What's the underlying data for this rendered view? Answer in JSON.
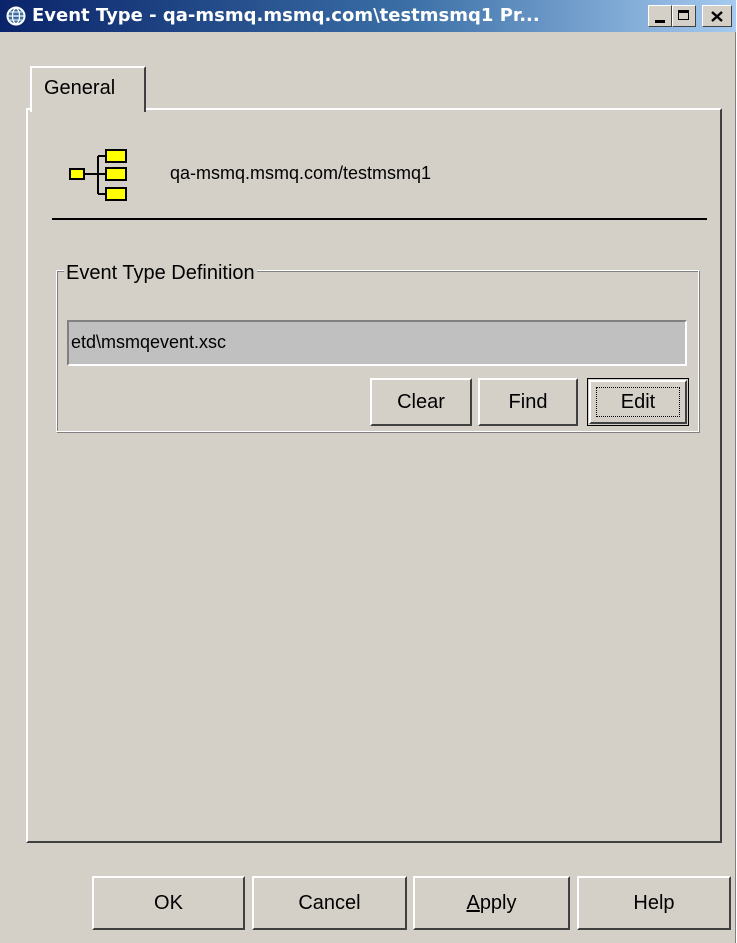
{
  "window": {
    "title": "Event Type - qa-msmq.msmq.com\\testmsmq1 Pr..."
  },
  "tabs": [
    {
      "label": "General",
      "selected": true
    }
  ],
  "general": {
    "queue_name": "qa-msmq.msmq.com/testmsmq1",
    "queue_icon": "tree-hierarchy-icon",
    "event_type_definition": {
      "label": "Event Type Definition",
      "value": "etd\\msmqevent.xsc",
      "buttons": {
        "clear": "Clear",
        "find": "Find",
        "edit": "Edit"
      }
    }
  },
  "footer": {
    "ok": "OK",
    "cancel": "Cancel",
    "apply_mnemonic": "A",
    "apply_rest": "pply",
    "help": "Help"
  },
  "colors": {
    "dialog_bg": "#d4d0c8",
    "title_start": "#0a246a",
    "title_end": "#a6caf0",
    "icon_yellow": "#ffff00"
  }
}
